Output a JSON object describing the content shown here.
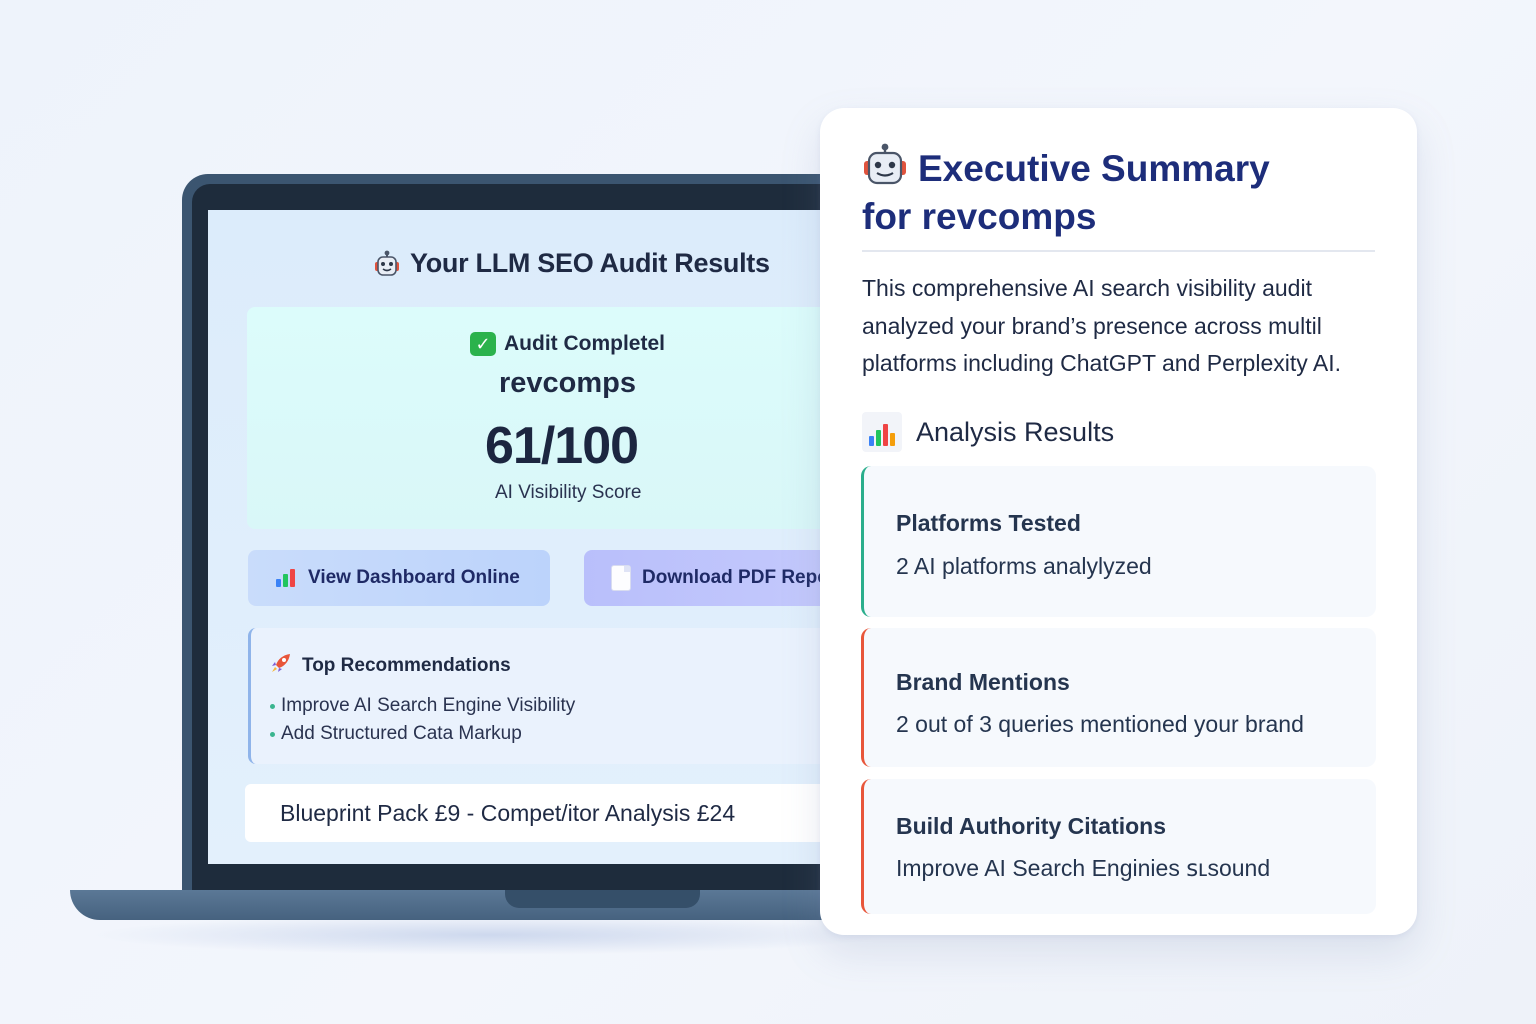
{
  "screen": {
    "title": "Your LLM SEO Audit Results",
    "status": "Audit Completel",
    "brand": "revcomps",
    "score": "61/100",
    "score_label": "AI Visibility Score",
    "buttons": {
      "dashboard": "View Dashboard Online",
      "pdf": "Download PDF Repo"
    },
    "recommendations": {
      "title": "Top Recommendations",
      "items": [
        "Improve AI Search Engine Visibility",
        "Add Structured Cata Markup"
      ]
    },
    "pricing": "Blueprint Pack £9 - Compet/itor Analysis £24"
  },
  "summary": {
    "title_line1": "Executive Summary",
    "title_line2": "for revcomps",
    "description": "This comprehensive AI search visibility audit analyzed your brand’s presence across multil platforms including ChatGPT and Perplexity AI.",
    "analysis_heading": "Analysis Results",
    "metrics": [
      {
        "title": "Platforms Tested",
        "value": "2 AI platforms analylyzed",
        "accent": "#2aae8c"
      },
      {
        "title": "Brand Mentions",
        "value": "2 out of 3 queries mentioned your brand",
        "accent": "#e8563a"
      },
      {
        "title": "Build Authority Citations",
        "value": "Improve AI Search Enginies ꜱʟsound",
        "accent": "#e8563a"
      }
    ]
  },
  "icons": {
    "title": "robot-icon",
    "status": "check-icon",
    "dashboard": "bar-chart-icon",
    "pdf": "document-icon",
    "recommendations": "rocket-icon",
    "analysis": "chart-icon"
  },
  "colors": {
    "heading_navy": "#1d2d7a",
    "success_green": "#2bb24c",
    "teal_accent": "#2aae8c",
    "orange_accent": "#e8563a"
  }
}
